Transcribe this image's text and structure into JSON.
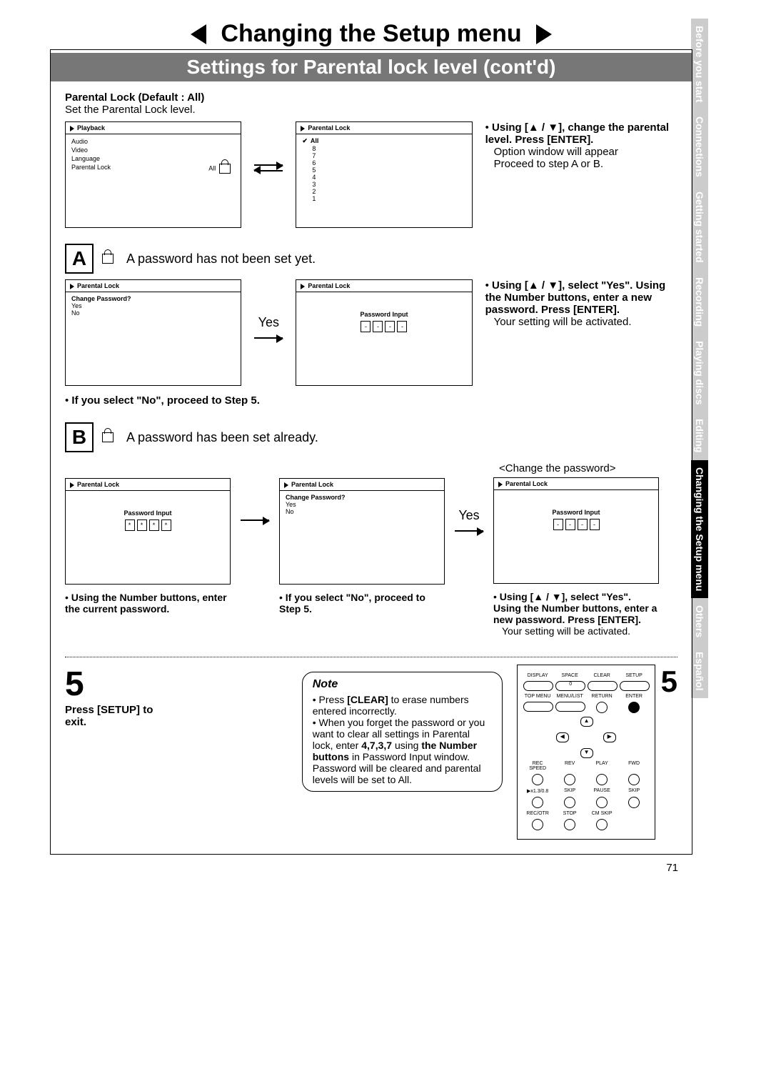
{
  "header": {
    "title": "Changing the Setup menu",
    "subtitle": "Settings for Parental lock level (cont'd)"
  },
  "intro": {
    "heading": "Parental Lock (Default : All)",
    "text": "Set the Parental Lock level."
  },
  "screen_playback": {
    "title": "Playback",
    "items": [
      "Audio",
      "Video",
      "Language",
      "Parental Lock"
    ],
    "pl_value": "All"
  },
  "screen_levels": {
    "title": "Parental Lock",
    "selected": "All",
    "levels": [
      "8",
      "7",
      "6",
      "5",
      "4",
      "3",
      "2",
      "1"
    ]
  },
  "instr1": {
    "bold": "Using [▲ / ▼], change the parental level. Press [ENTER].",
    "line1": "Option window will appear",
    "line2": "Proceed to step A or B."
  },
  "stepA": {
    "label": "A",
    "text": "A password has not been set yet."
  },
  "screen_change1": {
    "title": "Parental Lock",
    "heading": "Change Password?",
    "yes": "Yes",
    "no": "No"
  },
  "yes_label": "Yes",
  "screen_pwinput_empty": {
    "title": "Parental Lock",
    "label": "Password Input",
    "chars": [
      "-",
      "-",
      "-",
      "-"
    ]
  },
  "instrA": {
    "bold": "Using [▲ / ▼], select \"Yes\". Using the Number buttons, enter a new password. Press [ENTER].",
    "text": "Your setting will be activated."
  },
  "noteA_below": "If you select \"No\", proceed to Step 5.",
  "stepB": {
    "label": "B",
    "text": "A password has been set already."
  },
  "change_pw_title": "<Change the password>",
  "screen_pwinput_stars": {
    "title": "Parental Lock",
    "label": "Password Input",
    "chars": [
      "*",
      "*",
      "*",
      "*"
    ]
  },
  "screen_change2": {
    "title": "Parental Lock",
    "heading": "Change Password?",
    "yes": "Yes",
    "no": "No"
  },
  "instrB1": "Using the Number buttons, enter the current password.",
  "instrB2": "If you select \"No\", proceed to Step 5.",
  "instrB3": {
    "bold": "Using [▲ / ▼], select \"Yes\". Using the Number buttons, enter a new password. Press [ENTER].",
    "text": "Your setting will be activated."
  },
  "step5": {
    "num": "5",
    "text": "Press [SETUP] to exit."
  },
  "note": {
    "title": "Note",
    "b1a": "Press ",
    "b1b": "[CLEAR]",
    "b1c": " to erase numbers entered incorrectly.",
    "b2a": "When you forget the password or you want to clear all settings in Parental lock, enter ",
    "b2b": "4,7,3,7",
    "b2c": " using ",
    "b2d": "the Number buttons",
    "b2e": " in Password Input window. Password will be cleared and parental levels will be set to All."
  },
  "remote": {
    "r1": [
      "DISPLAY",
      "SPACE",
      "CLEAR",
      "SETUP"
    ],
    "r1b": [
      "",
      "0",
      "",
      ""
    ],
    "r2": [
      "TOP MENU",
      "MENU/LIST",
      "RETURN",
      "ENTER"
    ],
    "r3": [
      "REC SPEED",
      "REV",
      "PLAY",
      "FWD"
    ],
    "r4": [
      "▶x1.3/0.8",
      "SKIP",
      "PAUSE",
      "SKIP"
    ],
    "r5": [
      "REC/OTR",
      "STOP",
      "CM SKIP",
      ""
    ]
  },
  "side5": "5",
  "sidetabs": [
    "Before you start",
    "Connections",
    "Getting started",
    "Recording",
    "Playing discs",
    "Editing",
    "Changing the Setup menu",
    "Others",
    "Español"
  ],
  "active_tab_index": 6,
  "pagenum": "71"
}
